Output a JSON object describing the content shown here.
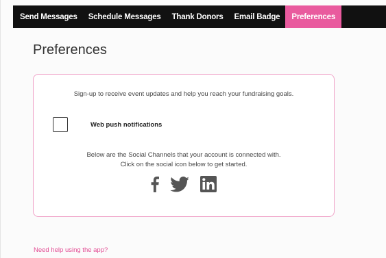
{
  "nav": {
    "items": [
      {
        "label": "Send Messages",
        "active": false
      },
      {
        "label": "Schedule Messages",
        "active": false
      },
      {
        "label": "Thank Donors",
        "active": false
      },
      {
        "label": "Email Badge",
        "active": false
      },
      {
        "label": "Preferences",
        "active": true
      }
    ]
  },
  "page": {
    "title": "Preferences"
  },
  "card": {
    "intro": "Sign-up to receive event updates and help you reach your fundraising goals.",
    "push": {
      "label": "Web push notifications",
      "checked": false
    },
    "social_text_line1": "Below are the Social Channels that your account is connected with.",
    "social_text_line2": "Click on the social icon below to get started.",
    "social_icons": [
      "facebook-icon",
      "twitter-icon",
      "linkedin-icon"
    ]
  },
  "help": {
    "link_text": "Need help using the app?"
  },
  "colors": {
    "nav_bg": "#111111",
    "accent": "#e95a9e",
    "card_border": "#f0a3c8",
    "link": "#e34d94",
    "icon": "#555555"
  }
}
